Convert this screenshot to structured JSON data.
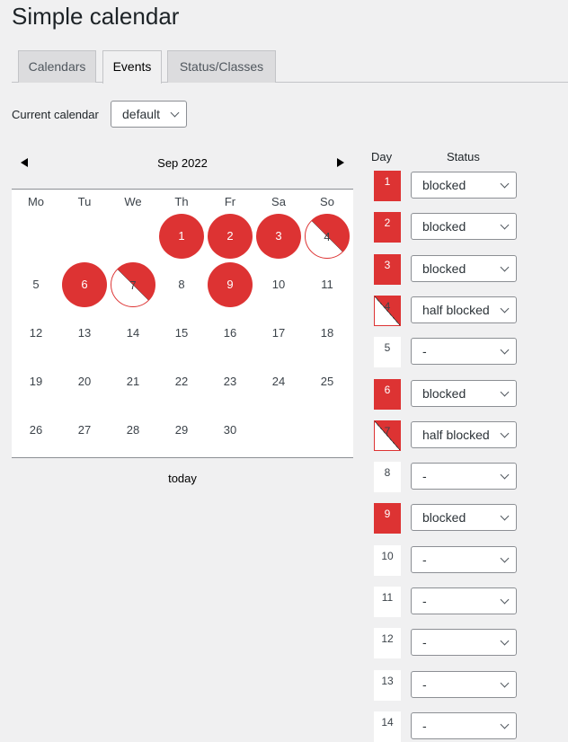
{
  "page": {
    "title": "Simple calendar"
  },
  "tabs": [
    {
      "label": "Calendars",
      "active": false
    },
    {
      "label": "Events",
      "active": true
    },
    {
      "label": "Status/Classes",
      "active": false
    }
  ],
  "current_calendar": {
    "label": "Current calendar",
    "value": "default"
  },
  "calendar": {
    "month_label": "Sep 2022",
    "weekdays": [
      "Mo",
      "Tu",
      "We",
      "Th",
      "Fr",
      "Sa",
      "So"
    ],
    "first_weekday_index": 3,
    "days_in_month": 30,
    "today_label": "today",
    "colors": {
      "blocked": "#dd3333"
    }
  },
  "list": {
    "day_header": "Day",
    "status_header": "Status",
    "rows": [
      {
        "day": "1",
        "status": "blocked"
      },
      {
        "day": "2",
        "status": "blocked"
      },
      {
        "day": "3",
        "status": "blocked"
      },
      {
        "day": "4",
        "status": "half blocked"
      },
      {
        "day": "5",
        "status": "-"
      },
      {
        "day": "6",
        "status": "blocked"
      },
      {
        "day": "7",
        "status": "half blocked"
      },
      {
        "day": "8",
        "status": "-"
      },
      {
        "day": "9",
        "status": "blocked"
      },
      {
        "day": "10",
        "status": "-"
      },
      {
        "day": "11",
        "status": "-"
      },
      {
        "day": "12",
        "status": "-"
      },
      {
        "day": "13",
        "status": "-"
      },
      {
        "day": "14",
        "status": "-"
      }
    ]
  }
}
